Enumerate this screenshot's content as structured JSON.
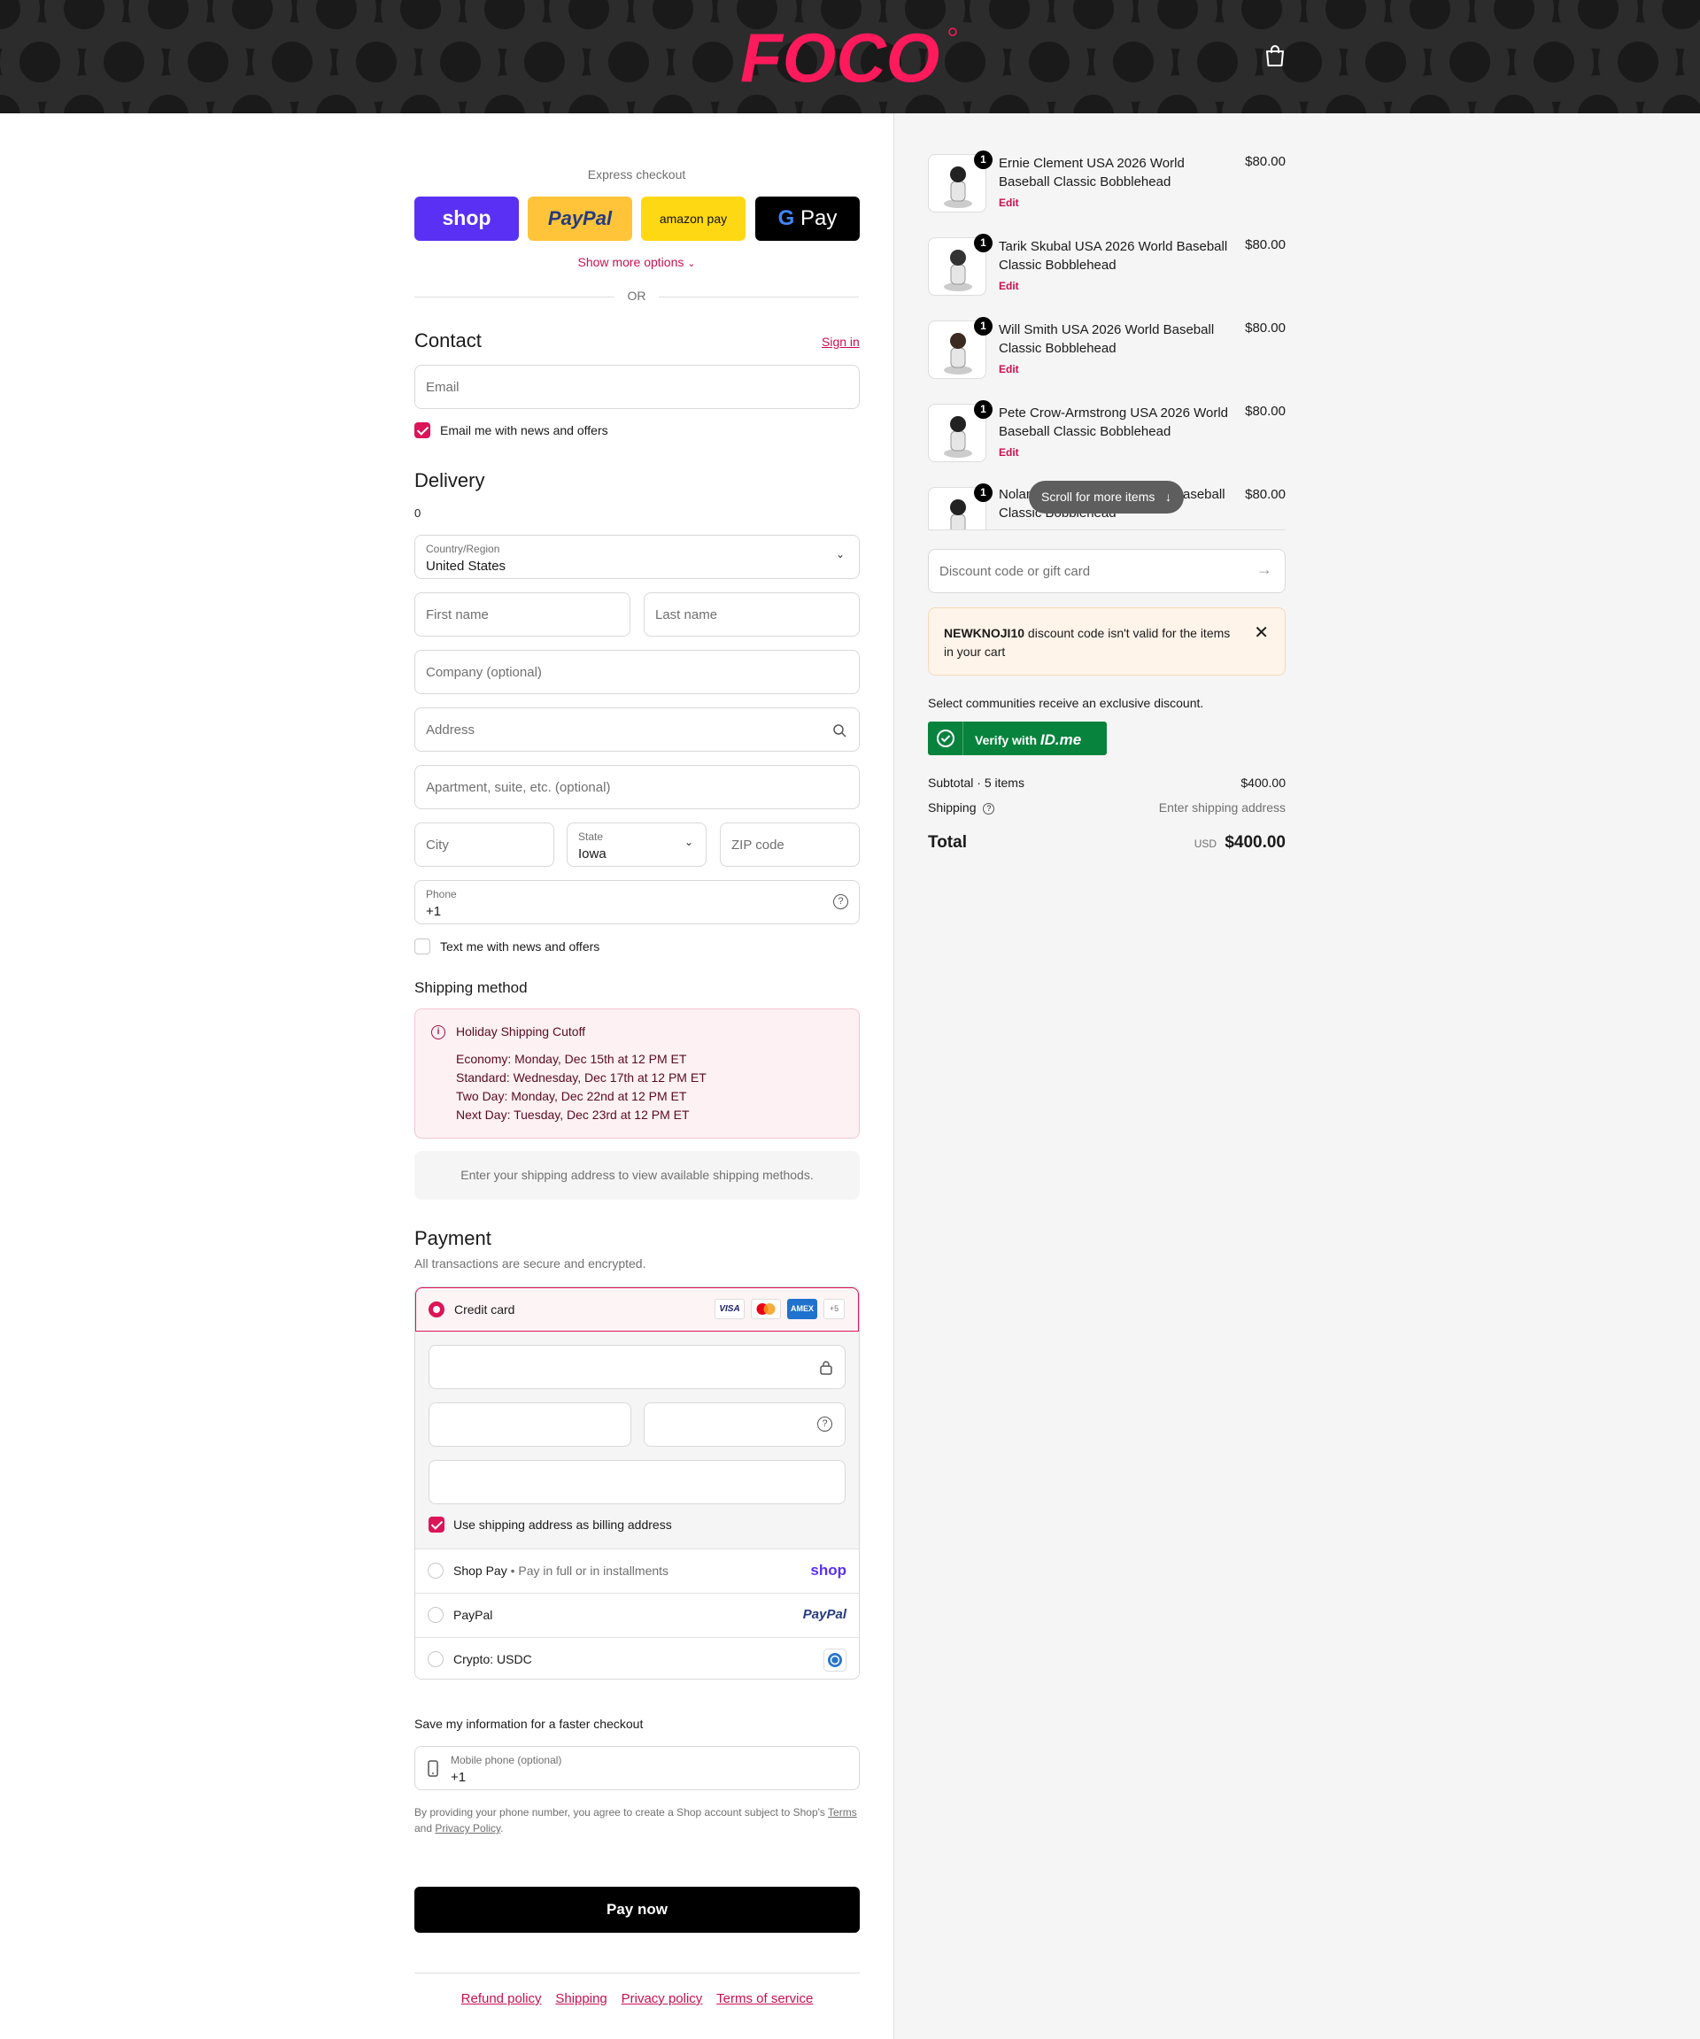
{
  "header": {
    "logo_text": "FOCO",
    "cart_icon": "shopping-bag-icon"
  },
  "express": {
    "heading": "Express checkout",
    "shop_label": "shop",
    "paypal_label": "PayPal",
    "amazon_label": "amazon pay",
    "gpay_label": "Pay",
    "show_more": "Show more options",
    "or": "OR"
  },
  "contact": {
    "title": "Contact",
    "sign_in": "Sign in",
    "email_placeholder": "Email",
    "newsletter_label": "Email me with news and offers",
    "newsletter_checked": true
  },
  "delivery": {
    "title": "Delivery",
    "count": "0",
    "country_label": "Country/Region",
    "country_value": "United States",
    "first_name": "First name",
    "last_name": "Last name",
    "company": "Company (optional)",
    "address": "Address",
    "apartment": "Apartment, suite, etc. (optional)",
    "city": "City",
    "state_label": "State",
    "state_value": "Iowa",
    "zip": "ZIP code",
    "phone_label": "Phone",
    "phone_value": "+1",
    "sms_label": "Text me with news and offers",
    "sms_checked": false
  },
  "shipping_method": {
    "title": "Shipping method",
    "notice_title": "Holiday Shipping Cutoff",
    "notice_lines": [
      "Economy: Monday, Dec 15th at 12 PM ET",
      "Standard: Wednesday, Dec 17th at 12 PM ET",
      "Two Day: Monday, Dec 22nd at 12 PM ET",
      "Next Day: Tuesday, Dec 23rd at 12 PM ET"
    ],
    "placeholder": "Enter your shipping address to view available shipping methods."
  },
  "payment": {
    "title": "Payment",
    "subtitle": "All transactions are secure and encrypted.",
    "credit_card": "Credit card",
    "card_brands": [
      "VISA",
      "mastercard",
      "AMEX",
      "+5"
    ],
    "billing_label": "Use shipping address as billing address",
    "billing_checked": true,
    "shop_pay": "Shop Pay",
    "shop_pay_sub": "Pay in full or in installments",
    "shop_pay_logo": "shop",
    "paypal": "PayPal",
    "paypal_logo": "PayPal",
    "crypto": "Crypto: USDC"
  },
  "save_info": {
    "title": "Save my information for a faster checkout",
    "mobile_label": "Mobile phone (optional)",
    "mobile_value": "+1",
    "disclaimer_1": "By providing your phone number, you agree to create a Shop account subject to Shop's",
    "terms": "Terms",
    "and": "and",
    "privacy": "Privacy Policy",
    "period": "."
  },
  "pay_now": "Pay now",
  "footer_links": [
    "Refund policy",
    "Shipping",
    "Privacy policy",
    "Terms of service"
  ],
  "cart": {
    "items": [
      {
        "qty": "1",
        "name": "Ernie Clement USA 2026 World Baseball Classic Bobblehead",
        "price": "$80.00",
        "edit": "Edit"
      },
      {
        "qty": "1",
        "name": "Tarik Skubal USA 2026 World Baseball Classic Bobblehead",
        "price": "$80.00",
        "edit": "Edit"
      },
      {
        "qty": "1",
        "name": "Will Smith USA 2026 World Baseball Classic Bobblehead",
        "price": "$80.00",
        "edit": "Edit"
      },
      {
        "qty": "1",
        "name": "Pete Crow-Armstrong USA 2026 World Baseball Classic Bobblehead",
        "price": "$80.00",
        "edit": "Edit"
      },
      {
        "qty": "1",
        "name_start": "Nolan",
        "name_end": "aseball",
        "name_line2": "Classic Bobblehead",
        "price": "$80.00"
      }
    ],
    "scroll_hint": "Scroll for more items",
    "discount_placeholder": "Discount code or gift card",
    "discount_code": "NEWKNOJI10",
    "discount_msg_1": " discount code isn't valid for the items",
    "discount_msg_2": "in your cart",
    "communities": "Select communities receive an exclusive discount.",
    "verify_label": "Verify with",
    "verify_brand": "ID.me",
    "subtotal_label": "Subtotal · 5 items",
    "subtotal_value": "$400.00",
    "shipping_label": "Shipping",
    "shipping_value": "Enter shipping address",
    "total_label": "Total",
    "currency": "USD",
    "total_value": "$400.00"
  },
  "colors": {
    "accent": "#dc1458",
    "link": "#c8114f",
    "shop_purple": "#5a31f4",
    "paypal_yellow": "#ffc439",
    "amazon_yellow": "#ffd814",
    "idme_green": "#08833d"
  }
}
